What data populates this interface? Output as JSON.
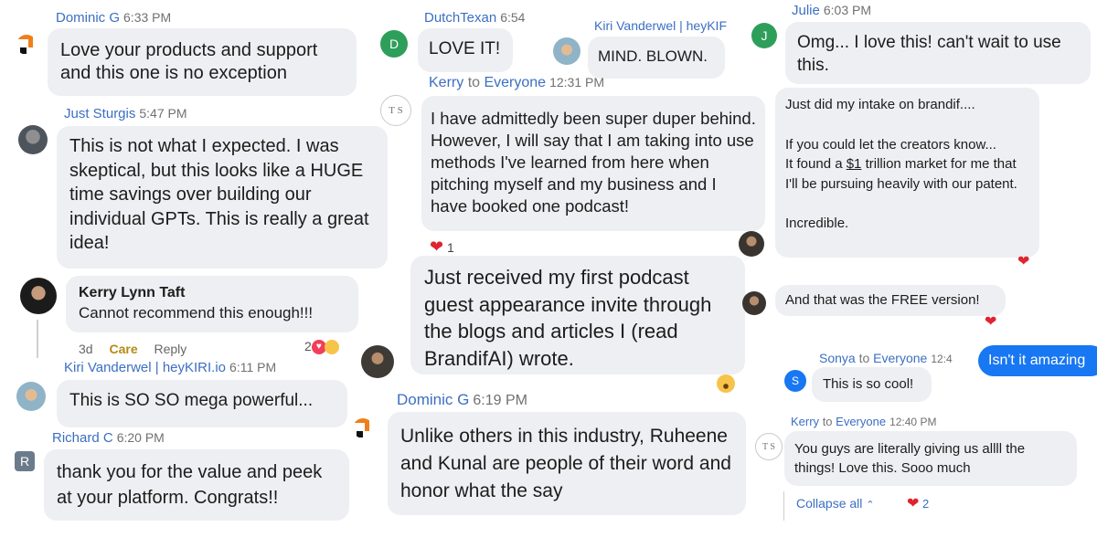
{
  "c1": {
    "name": "Dominic G",
    "time": "6:33 PM",
    "text": "Love your products and support and this one is no exception"
  },
  "c2": {
    "name": "Just Sturgis",
    "time": "5:47 PM",
    "text": "This is not what I expected. I was skeptical, but this looks like a HUGE time savings over building our individual GPTs. This is really a great idea!"
  },
  "c3": {
    "name": "Kerry Lynn Taft",
    "text": "Cannot recommend this enough!!!",
    "age": "3d",
    "care": "Care",
    "reply": "Reply",
    "reaction_count": "2"
  },
  "c4": {
    "name": "Kiri Vanderwel | heyKIRI.io",
    "time": "6:11 PM",
    "text": "This is SO SO mega powerful..."
  },
  "c5": {
    "name": "Richard C",
    "time": "6:20 PM",
    "avatar_letter": "R",
    "text": "thank you for the value and peek at your platform. Congrats!!"
  },
  "c6": {
    "name": "DutchTexan",
    "time": "6:54",
    "avatar_letter": "D",
    "text": "LOVE IT!"
  },
  "c7": {
    "name": "Kiri Vanderwel | heyKIF",
    "text": "MIND. BLOWN."
  },
  "c8": {
    "name": "Kerry",
    "to": "to",
    "recipient": "Everyone",
    "time": "12:31 PM",
    "initials": "T S",
    "text": "I have admittedly been super duper behind. However, I will say that I am taking into use methods I've learned from here when pitching myself and my business and I have booked one podcast!",
    "reaction_count": "1"
  },
  "c9": {
    "text": "Just received my first podcast guest appearance invite through the blogs and articles I (read BrandifAI) wrote."
  },
  "c10": {
    "name": "Dominic G",
    "time": "6:19 PM",
    "text": "Unlike others in this industry, Ruheene and Kunal are people of their word and honor what the say"
  },
  "c11": {
    "name": "Julie",
    "time": "6:03 PM",
    "avatar_letter": "J",
    "text": "Omg... I love this! can't wait to use this."
  },
  "c12": {
    "line1": "Just did my intake on brandif....",
    "line2": "If you could let the creators know...",
    "line3_pre": "It found a ",
    "line3_link": "$1",
    "line3_post": " trillion market for me that I'll be pursuing heavily with our patent.",
    "line4": "Incredible."
  },
  "c13": {
    "text": "And that was the FREE version!"
  },
  "c14": {
    "name": "Sonya",
    "to": "to",
    "recipient": "Everyone",
    "time": "12:4",
    "avatar_letter": "S",
    "text": "This is so cool!",
    "sent": "Isn't it amazing"
  },
  "c15": {
    "name": "Kerry",
    "to": "to",
    "recipient": "Everyone",
    "time": "12:40 PM",
    "initials": "T S",
    "text": "You guys are literally giving us allll the things! Love this. Sooo much",
    "collapse": "Collapse all",
    "reaction_count": "2"
  },
  "colors": {
    "name": "#3b6fc2",
    "bubble": "#eeeff2",
    "heart": "#e0242f",
    "sent": "#1877f2",
    "green": "#2e9e5b",
    "slate": "#6b7b8c",
    "care": "#b68a12"
  },
  "icons": [
    "brand-logo-icon",
    "heart-icon",
    "wow-emoji-icon",
    "hug-emoji-icon"
  ]
}
